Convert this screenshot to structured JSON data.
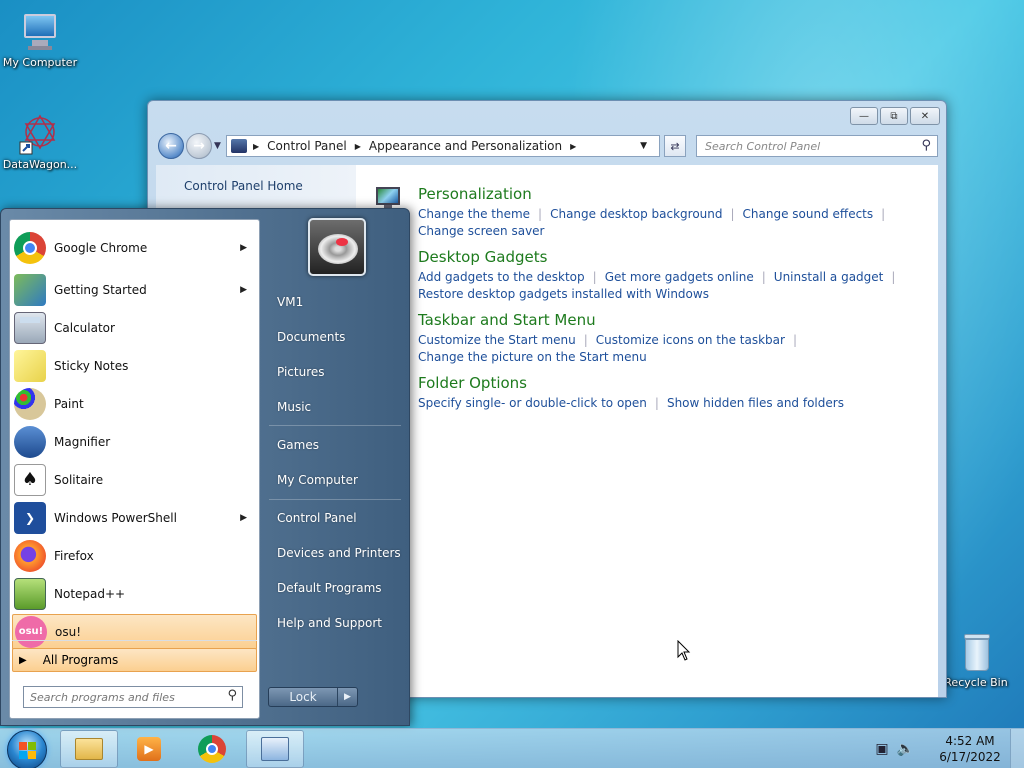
{
  "desktop": {
    "icons": [
      {
        "label": "My Computer"
      },
      {
        "label": "DataWagon..."
      },
      {
        "label": "Recycle Bin"
      }
    ]
  },
  "control_panel": {
    "address": [
      "Control Panel",
      "Appearance and Personalization"
    ],
    "search_placeholder": "Search Control Panel",
    "home_link": "Control Panel Home",
    "sections": [
      {
        "title": "Personalization",
        "links": [
          "Change the theme",
          "Change desktop background",
          "Change sound effects",
          "Change screen saver"
        ]
      },
      {
        "title": "Desktop Gadgets",
        "links": [
          "Add gadgets to the desktop",
          "Get more gadgets online",
          "Uninstall a gadget",
          "Restore desktop gadgets installed with Windows"
        ]
      },
      {
        "title": "Taskbar and Start Menu",
        "links": [
          "Customize the Start menu",
          "Customize icons on the taskbar",
          "Change the picture on the Start menu"
        ]
      },
      {
        "title": "Folder Options",
        "links": [
          "Specify single- or double-click to open",
          "Show hidden files and folders"
        ]
      }
    ]
  },
  "start_menu": {
    "programs": [
      {
        "label": "Google Chrome",
        "icon": "chrome-icon",
        "submenu": "▶"
      },
      {
        "label": "Getting Started",
        "icon": "getting-started-icon",
        "submenu": "▶"
      },
      {
        "label": "Calculator",
        "icon": "calculator-icon"
      },
      {
        "label": "Sticky Notes",
        "icon": "sticky-notes-icon"
      },
      {
        "label": "Paint",
        "icon": "paint-icon"
      },
      {
        "label": "Magnifier",
        "icon": "magnifier-icon"
      },
      {
        "label": "Solitaire",
        "icon": "solitaire-icon"
      },
      {
        "label": "Windows PowerShell",
        "icon": "powershell-icon",
        "submenu": "▶"
      },
      {
        "label": "Firefox",
        "icon": "firefox-icon"
      },
      {
        "label": "Notepad++",
        "icon": "notepadpp-icon"
      },
      {
        "label": "osu!",
        "icon": "osu-icon"
      }
    ],
    "all_programs": "All Programs",
    "search_placeholder": "Search programs and files",
    "right_items": [
      "VM1",
      "Documents",
      "Pictures",
      "Music",
      "Games",
      "My Computer",
      "Control Panel",
      "Devices and Printers",
      "Default Programs",
      "Help and Support"
    ],
    "lock_label": "Lock"
  },
  "taskbar": {
    "time": "4:52 AM",
    "date": "6/17/2022"
  },
  "colors": {
    "link": "#1e4f9a",
    "section_title": "#1e7b1e",
    "highlight": "#fbcf90"
  }
}
